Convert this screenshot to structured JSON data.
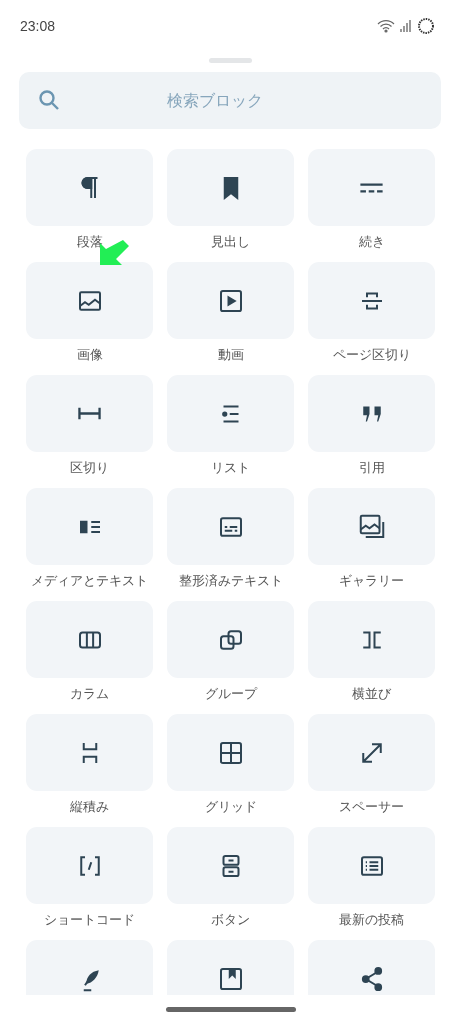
{
  "status_bar": {
    "time": "23:08"
  },
  "search": {
    "placeholder": "検索ブロック"
  },
  "blocks": [
    {
      "kind": "paragraph",
      "label": "段落",
      "highlighted": false
    },
    {
      "kind": "heading",
      "label": "見出し",
      "highlighted": false
    },
    {
      "kind": "more",
      "label": "続き",
      "highlighted": false
    },
    {
      "kind": "image",
      "label": "画像",
      "highlighted": true
    },
    {
      "kind": "video",
      "label": "動画",
      "highlighted": false
    },
    {
      "kind": "pagebreak",
      "label": "ページ区切り",
      "highlighted": false
    },
    {
      "kind": "separator",
      "label": "区切り",
      "highlighted": false
    },
    {
      "kind": "list",
      "label": "リスト",
      "highlighted": false
    },
    {
      "kind": "quote",
      "label": "引用",
      "highlighted": false
    },
    {
      "kind": "mediatext",
      "label": "メディアとテキスト",
      "highlighted": false
    },
    {
      "kind": "preformatted",
      "label": "整形済みテキスト",
      "highlighted": false
    },
    {
      "kind": "gallery",
      "label": "ギャラリー",
      "highlighted": false
    },
    {
      "kind": "columns",
      "label": "カラム",
      "highlighted": false
    },
    {
      "kind": "group",
      "label": "グループ",
      "highlighted": false
    },
    {
      "kind": "row",
      "label": "横並び",
      "highlighted": false
    },
    {
      "kind": "stack",
      "label": "縦積み",
      "highlighted": false
    },
    {
      "kind": "grid",
      "label": "グリッド",
      "highlighted": false
    },
    {
      "kind": "spacer",
      "label": "スペーサー",
      "highlighted": false
    },
    {
      "kind": "shortcode",
      "label": "ショートコード",
      "highlighted": false
    },
    {
      "kind": "buttons",
      "label": "ボタン",
      "highlighted": false
    },
    {
      "kind": "latestposts",
      "label": "最新の投稿",
      "highlighted": false
    },
    {
      "kind": "verse",
      "highlighted": false
    },
    {
      "kind": "bookmark",
      "highlighted": false
    },
    {
      "kind": "share",
      "highlighted": false
    }
  ]
}
